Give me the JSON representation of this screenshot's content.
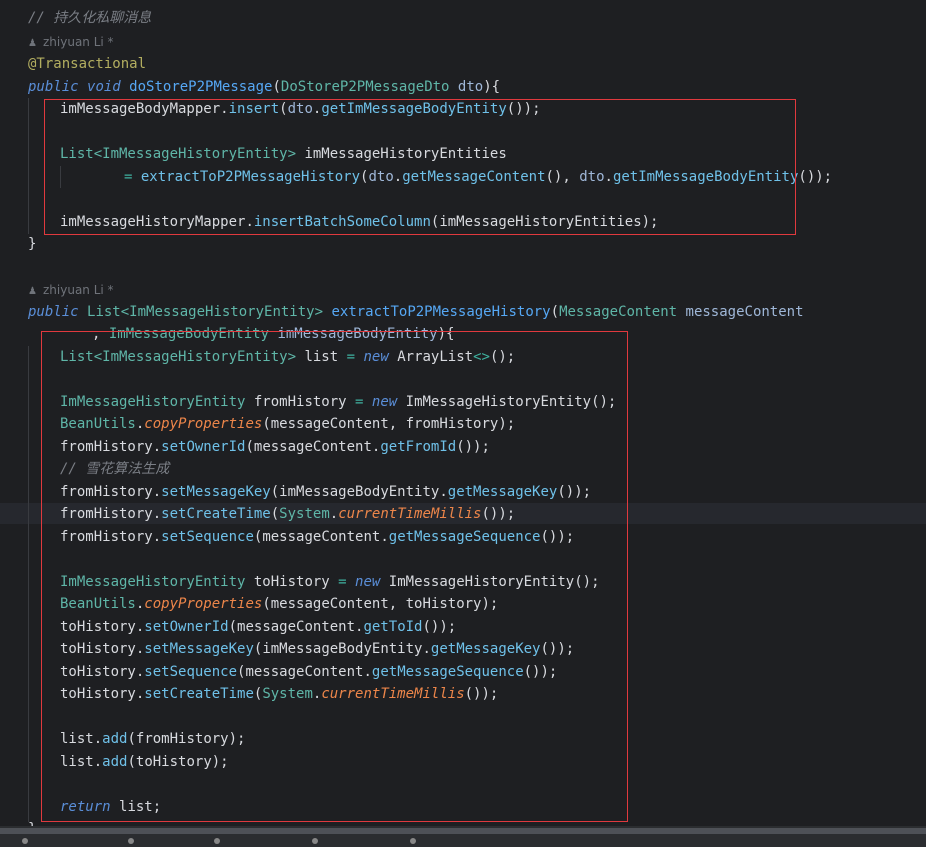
{
  "editor": {
    "comment1": "// 持久化私聊消息",
    "author1": "zhiyuan Li *",
    "annotation": "@Transactional",
    "m1": {
      "kw_public": "public",
      "kw_void": "void",
      "name": "doStoreP2PMessage",
      "param_type": "DoStoreP2PMessageDto",
      "param_name": "dto",
      "l1_obj": "imMessageBodyMapper",
      "l1_method": "insert",
      "l1_arg_obj": "dto",
      "l1_arg_method": "getImMessageBodyEntity",
      "l2_type": "List",
      "l2_generic": "<ImMessageHistoryEntity>",
      "l2_var": "imMessageHistoryEntities",
      "l3_method": "extractToP2PMessageHistory",
      "l3_arg1_obj": "dto",
      "l3_arg1_method": "getMessageContent",
      "l3_arg2_obj": "dto",
      "l3_arg2_method": "getImMessageBodyEntity",
      "l4_obj": "imMessageHistoryMapper",
      "l4_method": "insertBatchSomeColumn",
      "l4_arg": "imMessageHistoryEntities"
    },
    "author2": "zhiyuan Li *",
    "m2": {
      "kw_public": "public",
      "ret_type": "List",
      "ret_generic": "<ImMessageHistoryEntity>",
      "name": "extractToP2PMessageHistory",
      "p1_type": "MessageContent",
      "p1_name": "messageContent",
      "p2_type": "ImMessageBodyEntity",
      "p2_name": "imMessageBodyEntity",
      "list_type": "List",
      "list_generic": "<ImMessageHistoryEntity>",
      "list_var": "list",
      "kw_new": "new",
      "list_impl": "ArrayList",
      "diamond": "<>",
      "entity_type": "ImMessageHistoryEntity",
      "from_var": "fromHistory",
      "to_var": "toHistory",
      "bean_utils": "BeanUtils",
      "copy_props": "copyProperties",
      "mc": "messageContent",
      "mbe": "imMessageBodyEntity",
      "set_owner": "setOwnerId",
      "get_from": "getFromId",
      "get_to": "getToId",
      "snow_comment": "// 雪花算法生成",
      "set_key": "setMessageKey",
      "get_key": "getMessageKey",
      "set_time": "setCreateTime",
      "system": "System",
      "millis": "currentTimeMillis",
      "set_seq": "setSequence",
      "get_seq": "getMessageSequence",
      "add": "add",
      "kw_return": "return"
    }
  }
}
